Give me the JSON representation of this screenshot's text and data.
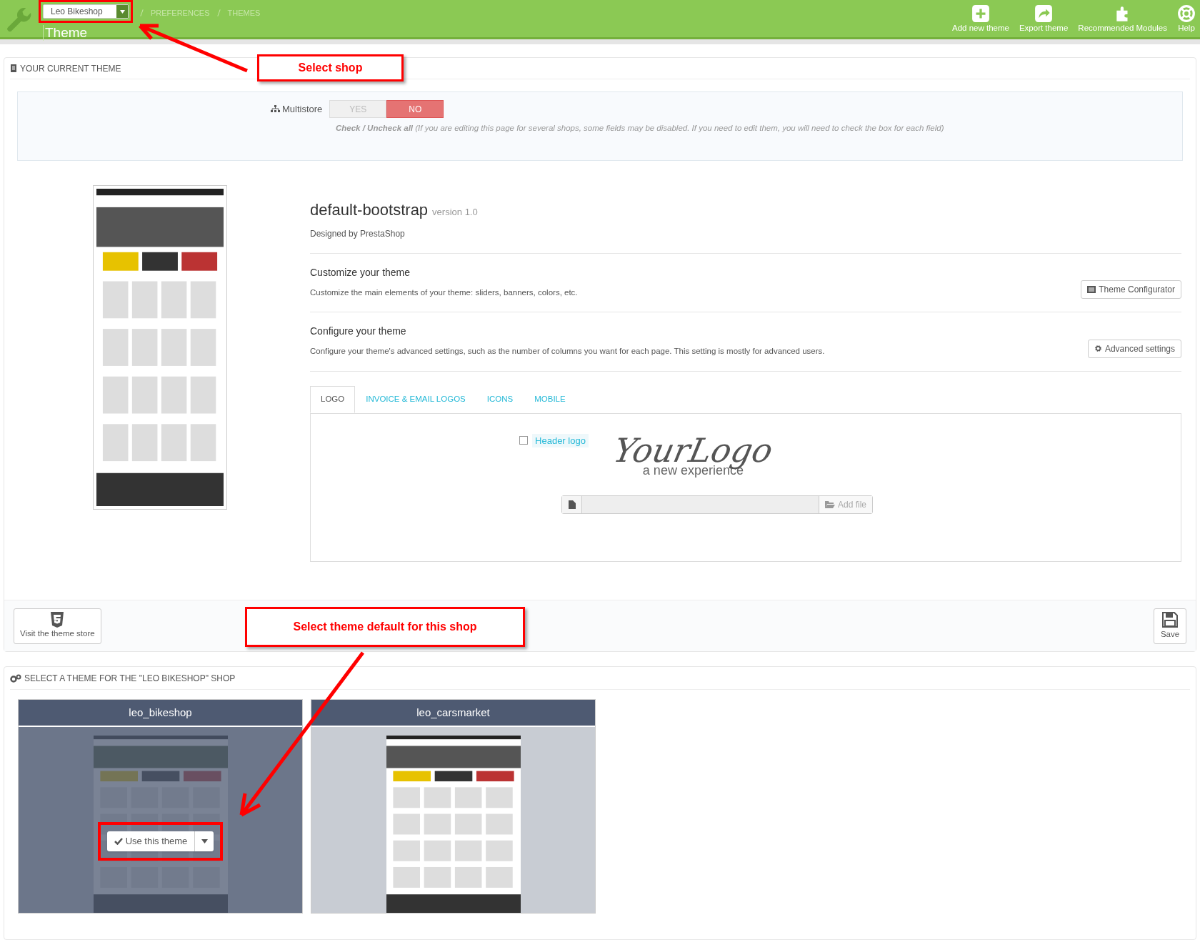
{
  "header": {
    "shop_selector": "Leo Bikeshop",
    "breadcrumb": [
      "PREFERENCES",
      "THEMES"
    ],
    "title": "Theme",
    "toolbar": [
      {
        "label": "Add new theme",
        "kind": "add"
      },
      {
        "label": "Export theme",
        "kind": "export"
      },
      {
        "label": "Recommended Modules",
        "kind": "modules"
      },
      {
        "label": "Help",
        "kind": "help"
      }
    ]
  },
  "current_theme_panel": {
    "title": "YOUR CURRENT THEME",
    "multistore": {
      "label": "Multistore",
      "options": [
        {
          "label": "YES",
          "selected": false
        },
        {
          "label": "NO",
          "selected": true
        }
      ],
      "hint": "**Check / Uncheck all** (If you are editing this page for several shops, some fields may be disabled. If you need to edit them, you will need to check the box for each field)"
    },
    "theme": {
      "name": "default-bootstrap",
      "version": "version 1.0",
      "designer": "Designed by PrestaShop"
    },
    "sections": [
      {
        "title": "Customize your theme",
        "description": "Customize the main elements of your theme: sliders, banners, colors, etc.",
        "button": "Theme Configurator",
        "kind": "configurator"
      },
      {
        "title": "Configure your theme",
        "description": "Configure your theme's advanced settings, such as the number of columns you want for each page. This setting is mostly for advanced users.",
        "button": "Advanced settings",
        "kind": "advanced"
      }
    ],
    "tabs": [
      {
        "label": "LOGO",
        "selected": true
      },
      {
        "label": "INVOICE & EMAIL LOGOS",
        "selected": false
      },
      {
        "label": "ICONS",
        "selected": false
      },
      {
        "label": "MOBILE",
        "selected": false
      }
    ],
    "logo_field": {
      "label": "Header logo",
      "checked": false,
      "logo_text": "YourLogo",
      "logo_tagline": "a new experience",
      "add_file": "Add file"
    },
    "footer": {
      "store_link": "Visit the theme store",
      "save": "Save"
    }
  },
  "select_theme_panel": {
    "title": "SELECT A THEME FOR THE \"LEO BIKESHOP\" SHOP",
    "themes": [
      {
        "name": "leo_bikeshop",
        "hovered": true,
        "action": "Use this theme"
      },
      {
        "name": "leo_carsmarket",
        "hovered": false
      }
    ]
  },
  "annotations": [
    {
      "text": "Select shop"
    },
    {
      "text": "Select theme default for this shop"
    }
  ]
}
